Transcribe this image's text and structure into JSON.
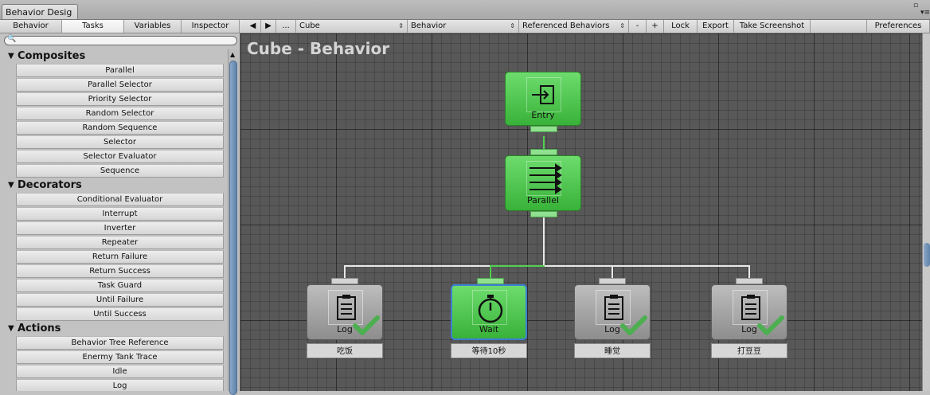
{
  "window": {
    "tab_title": "Behavior Desig",
    "restore_glyph": "▫",
    "menu_glyph": "▾≡"
  },
  "toolbar": {
    "tabs": [
      "Behavior",
      "Tasks",
      "Variables",
      "Inspector"
    ],
    "active_tab": "Tasks",
    "back_glyph": "◀",
    "forward_glyph": "▶",
    "more_label": "...",
    "object_select": "Cube",
    "behavior_select": "Behavior",
    "referenced": "Referenced Behaviors",
    "minus": "-",
    "plus": "+",
    "lock": "Lock",
    "export": "Export",
    "screenshot": "Take Screenshot",
    "preferences": "Preferences",
    "dropdown_glyph": "⇕"
  },
  "search": {
    "icon_glyph": "🔍",
    "placeholder": ""
  },
  "panel": {
    "collapse_glyph": "▼",
    "composites": {
      "title": "Composites",
      "items": [
        "Parallel",
        "Parallel Selector",
        "Priority Selector",
        "Random Selector",
        "Random Sequence",
        "Selector",
        "Selector Evaluator",
        "Sequence"
      ]
    },
    "decorators": {
      "title": "Decorators",
      "items": [
        "Conditional Evaluator",
        "Interrupt",
        "Inverter",
        "Repeater",
        "Return Failure",
        "Return Success",
        "Task Guard",
        "Until Failure",
        "Until Success"
      ]
    },
    "actions": {
      "title": "Actions",
      "items": [
        "Behavior Tree Reference",
        "Enermy Tank Trace",
        "Idle",
        "Log"
      ]
    },
    "scroll_up_glyph": "▲"
  },
  "graph": {
    "title": "Cube - Behavior",
    "entry": {
      "label": "Entry"
    },
    "parallel": {
      "label": "Parallel"
    },
    "children": [
      {
        "label": "Log",
        "comment": "吃饭",
        "status": "success"
      },
      {
        "label": "Wait",
        "comment": "等待10秒",
        "status": "running"
      },
      {
        "label": "Log",
        "comment": "睡觉",
        "status": "success"
      },
      {
        "label": "Log",
        "comment": "打豆豆",
        "status": "success"
      }
    ]
  },
  "colors": {
    "running": "#39b239",
    "success_check": "#4caf50",
    "selection": "#3b7fd6"
  }
}
